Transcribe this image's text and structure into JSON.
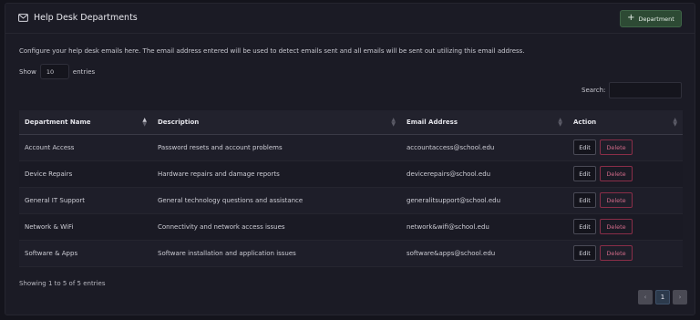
{
  "header": {
    "title": "Help Desk Departments",
    "add_button": "Department"
  },
  "description": "Configure your help desk emails here. The email address entered will be used to detect emails sent and all emails will be sent out utilizing this email address.",
  "length": {
    "show": "Show",
    "value": "10",
    "entries": "entries"
  },
  "search": {
    "label": "Search:"
  },
  "columns": [
    "Department Name",
    "Description",
    "Email Address",
    "Action"
  ],
  "rows": [
    {
      "name": "Account Access",
      "description": "Password resets and account problems",
      "email": "accountaccess@school.edu"
    },
    {
      "name": "Device Repairs",
      "description": "Hardware repairs and damage reports",
      "email": "devicerepairs@school.edu"
    },
    {
      "name": "General IT Support",
      "description": "General technology questions and assistance",
      "email": "generalitsupport@school.edu"
    },
    {
      "name": "Network & WiFi",
      "description": "Connectivity and network access issues",
      "email": "network&wifi@school.edu"
    },
    {
      "name": "Software & Apps",
      "description": "Software installation and application issues",
      "email": "software&apps@school.edu"
    }
  ],
  "actions": {
    "edit": "Edit",
    "delete": "Delete"
  },
  "info": "Showing 1 to 5 of 5 entries",
  "pagination": {
    "prev": "‹",
    "current": "1",
    "next": "›"
  },
  "colors": {
    "accent_green": "#2d4a34",
    "delete_red": "#8a2e48"
  }
}
